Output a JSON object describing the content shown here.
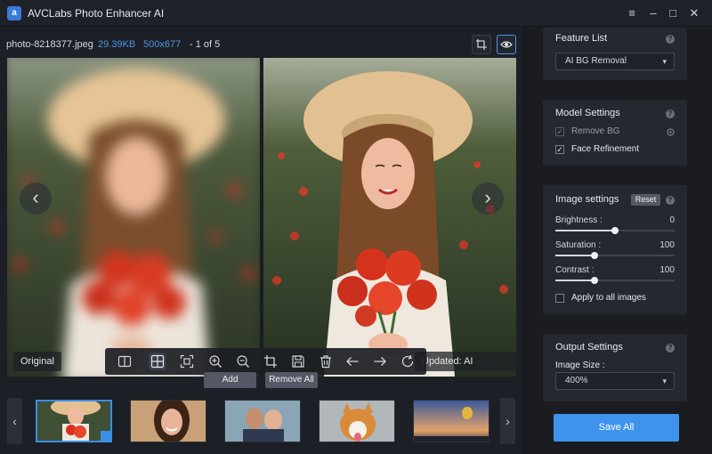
{
  "app": {
    "title": "AVCLabs Photo Enhancer AI",
    "logo_letter": "a",
    "window_controls": [
      "≡",
      "–",
      "□",
      "✕"
    ]
  },
  "file": {
    "name": "photo-8218377.jpeg",
    "size": "29.39KB",
    "dimensions": "500x677",
    "position": "- 1 of 5"
  },
  "preview": {
    "original_label": "Original",
    "updated_label": "Updated: AI Upscaler",
    "prev_arrow": "‹",
    "next_arrow": "›"
  },
  "thumbs_bar": {
    "add_label": "Add",
    "remove_all_label": "Remove All",
    "prev_arrow": "‹",
    "next_arrow": "›",
    "thumbnails": [
      "woman with flowers",
      "smiling woman",
      "couple",
      "corgi dog",
      "hot air balloon"
    ]
  },
  "panel": {
    "feature_list": {
      "title": "Feature List",
      "selected": "AI BG Removal"
    },
    "model_settings": {
      "title": "Model Settings",
      "remove_bg_label": "Remove BG",
      "remove_bg_checked": true,
      "face_refinement_label": "Face Refinement",
      "face_refinement_checked": true
    },
    "image_settings": {
      "title": "Image settings",
      "reset_label": "Reset",
      "brightness_label": "Brightness :",
      "brightness_value": "0",
      "brightness_level": 0.5,
      "saturation_label": "Saturation :",
      "saturation_value": "100",
      "saturation_level": 0.33,
      "contrast_label": "Contrast :",
      "contrast_value": "100",
      "contrast_level": 0.33,
      "apply_all_label": "Apply to all images",
      "apply_all_checked": false
    },
    "output_settings": {
      "title": "Output Settings",
      "image_size_label": "Image Size :",
      "image_size_value": "400%"
    },
    "save_all_label": "Save All"
  },
  "colors": {
    "accent": "#3f93ec",
    "link_blue": "#4c95e6",
    "background": "#1b1d24",
    "card": "#25282f"
  }
}
